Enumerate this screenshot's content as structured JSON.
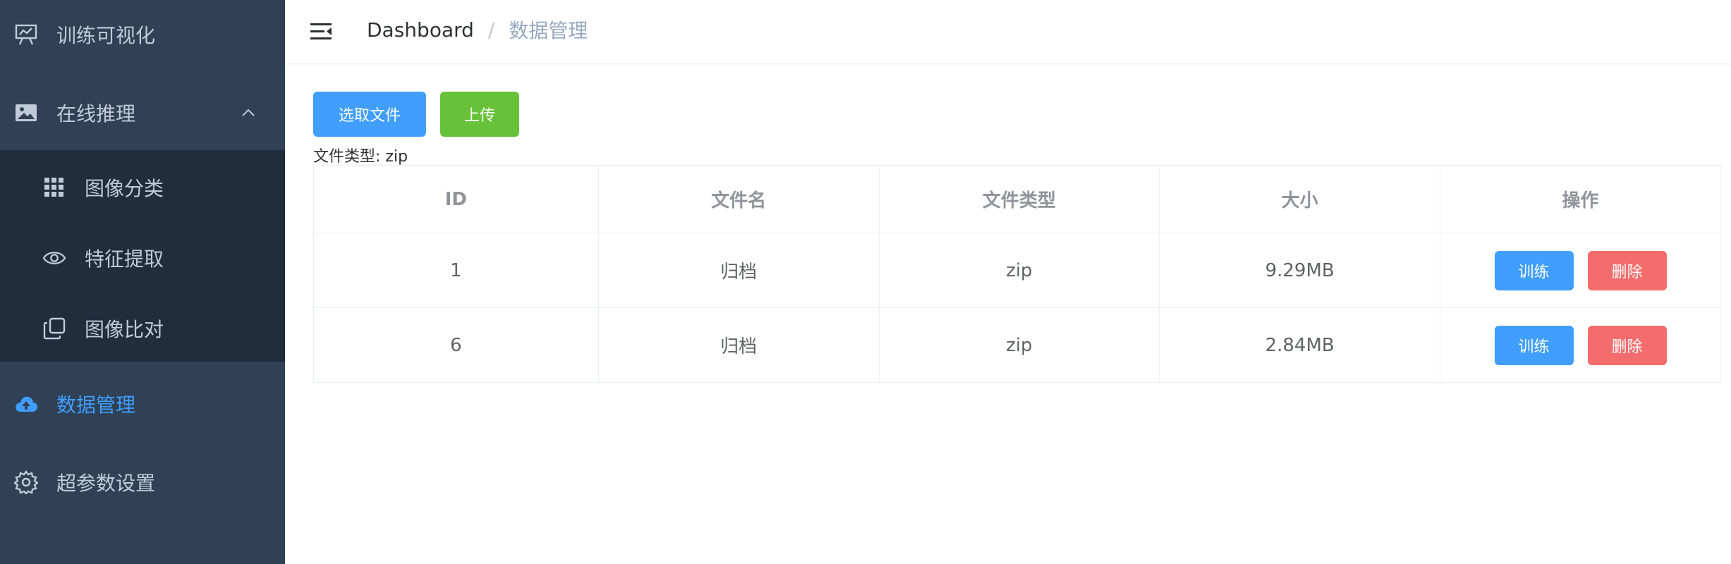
{
  "sidebar": {
    "items": [
      {
        "label": "训练可视化",
        "icon": "presentation-icon"
      },
      {
        "label": "在线推理",
        "icon": "image-icon"
      },
      {
        "label": "数据管理",
        "icon": "cloud-upload-icon"
      },
      {
        "label": "超参数设置",
        "icon": "gear-icon"
      }
    ],
    "submenu": [
      {
        "label": "图像分类",
        "icon": "grid-icon"
      },
      {
        "label": "特征提取",
        "icon": "eye-icon"
      },
      {
        "label": "图像比对",
        "icon": "copy-icon"
      }
    ],
    "colors": {
      "bg": "#304156",
      "sub_bg": "#1f2d3d",
      "text": "#bfcbd9",
      "active": "#409eff"
    }
  },
  "navbar": {
    "breadcrumb_home": "Dashboard",
    "breadcrumb_sep": "/",
    "breadcrumb_current": "数据管理"
  },
  "toolbar": {
    "select_label": "选取文件",
    "upload_label": "上传",
    "hint": "文件类型: zip"
  },
  "table": {
    "headers": [
      "ID",
      "文件名",
      "文件类型",
      "大小",
      "操作"
    ],
    "rows": [
      {
        "id": "1",
        "name": "归档",
        "type": "zip",
        "size": "9.29MB"
      },
      {
        "id": "6",
        "name": "归档",
        "type": "zip",
        "size": "2.84MB"
      }
    ],
    "train_label": "训练",
    "delete_label": "删除"
  }
}
